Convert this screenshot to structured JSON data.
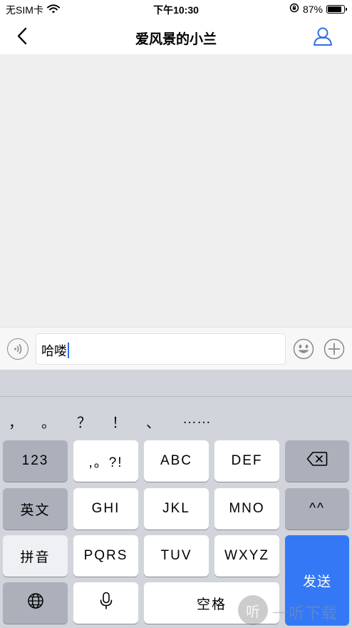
{
  "status_bar": {
    "carrier": "无SIM卡",
    "time": "下午10:30",
    "battery_percent": "87%",
    "battery_level": 0.87,
    "icons": [
      "wifi-icon",
      "rotation-lock-icon",
      "battery-icon"
    ]
  },
  "nav": {
    "title": "爱风景的小兰",
    "icons": [
      "chevron-left-icon",
      "user-icon"
    ]
  },
  "input_bar": {
    "text": "哈喽",
    "icons": [
      "voice-icon",
      "emoji-icon",
      "plus-icon"
    ]
  },
  "keyboard": {
    "candidates": [
      "，",
      "。",
      "？",
      "！",
      "、",
      "……"
    ],
    "keys": {
      "numbers": "123",
      "punct": ",。?!",
      "abc": "ABC",
      "def": "DEF",
      "english": "英文",
      "ghi": "GHI",
      "jkl": "JKL",
      "mno": "MNO",
      "emoticon": "^^",
      "pinyin": "拼音",
      "pqrs": "PQRS",
      "tuv": "TUV",
      "wxyz": "WXYZ",
      "send": "发送",
      "space": "空格"
    },
    "icons": [
      "backspace-icon",
      "globe-icon",
      "microphone-icon"
    ]
  },
  "watermark": {
    "text": "一听下载",
    "badge": "听"
  },
  "colors": {
    "accent": "#3478f6",
    "chat_background": "#efefef",
    "keyboard_background": "#d1d4da"
  }
}
